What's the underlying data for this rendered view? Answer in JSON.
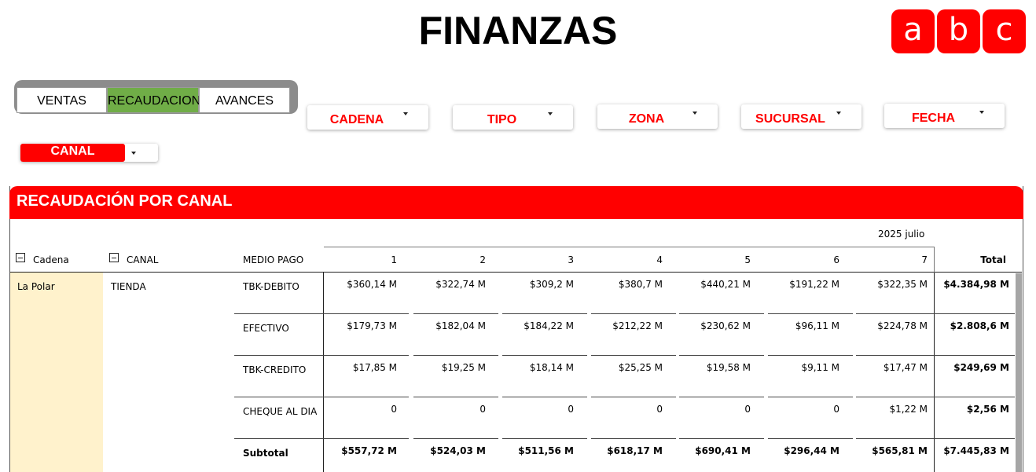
{
  "header": {
    "title": "FINANZAS",
    "logo_letters": [
      "a",
      "b",
      "c"
    ]
  },
  "nav": {
    "tabs": [
      {
        "label": "VENTAS",
        "active": false
      },
      {
        "label": "RECAUDACION",
        "active": true
      },
      {
        "label": "AVANCES",
        "active": false
      }
    ]
  },
  "filters": {
    "cadena": "CADENA",
    "tipo": "TIPO",
    "zona": "ZONA",
    "sucursal": "SUCURSAL",
    "fecha": "FECHA",
    "canal": "CANAL"
  },
  "colors": {
    "brand": "#ff0000",
    "active_tab": "#70ad47",
    "row_header_bg": "#fff2cc"
  },
  "table": {
    "title": "RECAUDACIÓN POR CANAL",
    "period": "2025 julio",
    "row_headers": [
      "Cadena",
      "CANAL",
      "MEDIO PAGO"
    ],
    "day_columns": [
      "1",
      "2",
      "3",
      "4",
      "5",
      "6",
      "7"
    ],
    "total_label": "Total",
    "cadena": "La Polar",
    "canal": "TIENDA",
    "rows": [
      {
        "medio": "TBK-DEBITO",
        "values": [
          "$360,14 M",
          "$322,74 M",
          "$309,2 M",
          "$380,7 M",
          "$440,21 M",
          "$191,22 M",
          "$322,35 M"
        ],
        "total": "$4.384,98 M"
      },
      {
        "medio": "EFECTIVO",
        "values": [
          "$179,73 M",
          "$182,04 M",
          "$184,22 M",
          "$212,22 M",
          "$230,62 M",
          "$96,11 M",
          "$224,78 M"
        ],
        "total": "$2.808,6 M"
      },
      {
        "medio": "TBK-CREDITO",
        "values": [
          "$17,85 M",
          "$19,25 M",
          "$18,14 M",
          "$25,25 M",
          "$19,58 M",
          "$9,11 M",
          "$17,47 M"
        ],
        "total": "$249,69 M"
      },
      {
        "medio": "CHEQUE AL DIA",
        "values": [
          "0",
          "0",
          "0",
          "0",
          "0",
          "0",
          "$1,22 M"
        ],
        "total": "$2,56 M"
      }
    ],
    "subtotal": {
      "label": "Subtotal",
      "values": [
        "$557,72 M",
        "$524,03 M",
        "$511,56 M",
        "$618,17 M",
        "$690,41 M",
        "$296,44 M",
        "$565,81 M"
      ],
      "total": "$7.445,83 M"
    }
  }
}
